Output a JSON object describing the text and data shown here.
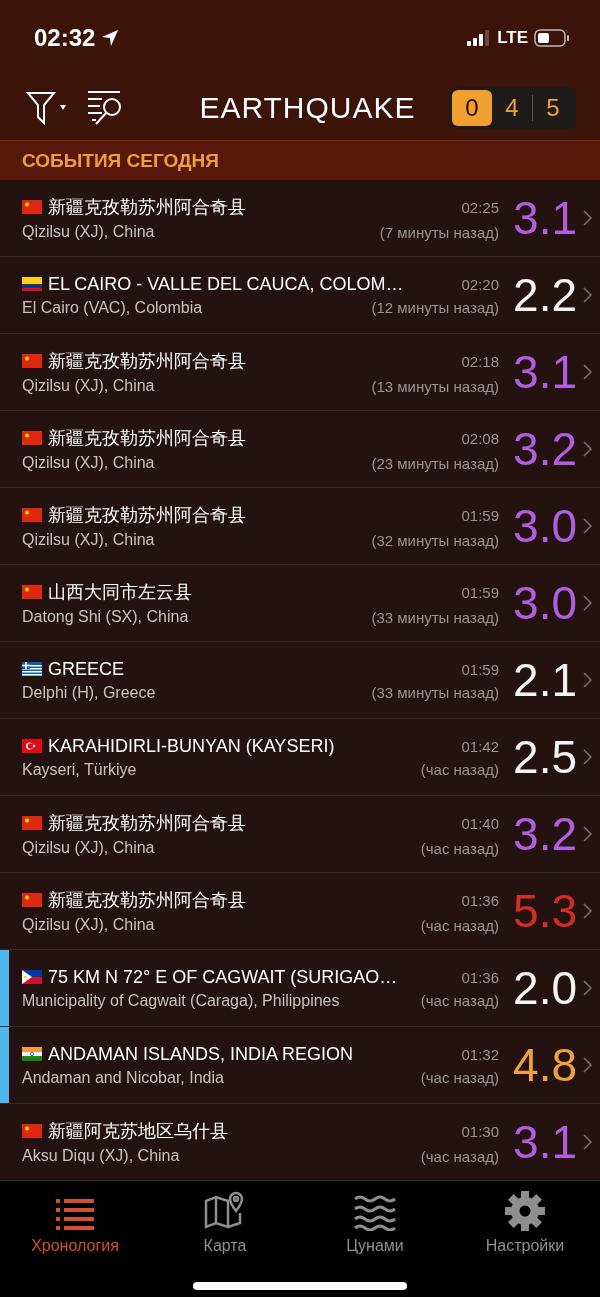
{
  "status_bar": {
    "time": "02:32",
    "network": "LTE"
  },
  "header": {
    "title": "EARTHQUAKE",
    "counters": [
      {
        "label": "0",
        "selected": true
      },
      {
        "label": "4",
        "selected": false
      },
      {
        "label": "5",
        "selected": false
      }
    ]
  },
  "section": {
    "title": "СОБЫТИЯ СЕГОДНЯ"
  },
  "events": [
    {
      "kind": "cn",
      "title": "新疆克孜勒苏州阿合奇县",
      "place": "Qizilsu (XJ), China",
      "time": "02:25",
      "ago": "(7 минуты назад)",
      "magnitude": "3.1",
      "color": "#b25ee0",
      "marked": false
    },
    {
      "kind": "co",
      "title": "EL CAIRO - VALLE DEL CAUCA, COLOM…",
      "place": "El Cairo (VAC), Colombia",
      "time": "02:20",
      "ago": "(12 минуты назад)",
      "magnitude": "2.2",
      "color": "#f4f4f4",
      "marked": false
    },
    {
      "kind": "cn",
      "title": "新疆克孜勒苏州阿合奇县",
      "place": "Qizilsu (XJ), China",
      "time": "02:18",
      "ago": "(13 минуты назад)",
      "magnitude": "3.1",
      "color": "#b25ee0",
      "marked": false
    },
    {
      "kind": "cn",
      "title": "新疆克孜勒苏州阿合奇县",
      "place": "Qizilsu (XJ), China",
      "time": "02:08",
      "ago": "(23 минуты назад)",
      "magnitude": "3.2",
      "color": "#b25ee0",
      "marked": false
    },
    {
      "kind": "cn",
      "title": "新疆克孜勒苏州阿合奇县",
      "place": "Qizilsu (XJ), China",
      "time": "01:59",
      "ago": "(32 минуты назад)",
      "magnitude": "3.0",
      "color": "#b25ee0",
      "marked": false
    },
    {
      "kind": "cn",
      "title": "山西大同市左云县",
      "place": "Datong Shi (SX), China",
      "time": "01:59",
      "ago": "(33 минуты назад)",
      "magnitude": "3.0",
      "color": "#b25ee0",
      "marked": false
    },
    {
      "kind": "gr",
      "title": "GREECE",
      "place": "Delphi (H), Greece",
      "time": "01:59",
      "ago": "(33 минуты назад)",
      "magnitude": "2.1",
      "color": "#f4f4f4",
      "marked": false
    },
    {
      "kind": "tr",
      "title": "KARAHIDIRLI-BUNYAN (KAYSERI)",
      "place": "Kayseri, Türkiye",
      "time": "01:42",
      "ago": "(час назад)",
      "magnitude": "2.5",
      "color": "#f4f4f4",
      "marked": false
    },
    {
      "kind": "cn",
      "title": "新疆克孜勒苏州阿合奇县",
      "place": "Qizilsu (XJ), China",
      "time": "01:40",
      "ago": "(час назад)",
      "magnitude": "3.2",
      "color": "#b25ee0",
      "marked": false
    },
    {
      "kind": "cn",
      "title": "新疆克孜勒苏州阿合奇县",
      "place": "Qizilsu (XJ), China",
      "time": "01:36",
      "ago": "(час назад)",
      "magnitude": "5.3",
      "color": "#d42b25",
      "marked": false
    },
    {
      "kind": "ph",
      "title": "75 KM N 72° E OF CAGWAIT (SURIGAO…",
      "place": "Municipality of Cagwait (Caraga), Philippines",
      "time": "01:36",
      "ago": "(час назад)",
      "magnitude": "2.0",
      "color": "#f4f4f4",
      "marked": true
    },
    {
      "kind": "in",
      "title": "ANDAMAN ISLANDS, INDIA REGION",
      "place": "Andaman and Nicobar, India",
      "time": "01:32",
      "ago": "(час назад)",
      "magnitude": "4.8",
      "color": "#eea23c",
      "marked": true
    },
    {
      "kind": "cn",
      "title": "新疆阿克苏地区乌什县",
      "place": "Aksu Diqu (XJ), China",
      "time": "01:30",
      "ago": "(час назад)",
      "magnitude": "3.1",
      "color": "#b25ee0",
      "marked": false
    }
  ],
  "tab_bar": [
    {
      "kind": "list",
      "label": "Хронология",
      "selected": true
    },
    {
      "kind": "map",
      "label": "Карта",
      "selected": false
    },
    {
      "kind": "waves",
      "label": "Цунами",
      "selected": false
    },
    {
      "kind": "gear",
      "label": "Настройки",
      "selected": false
    }
  ]
}
